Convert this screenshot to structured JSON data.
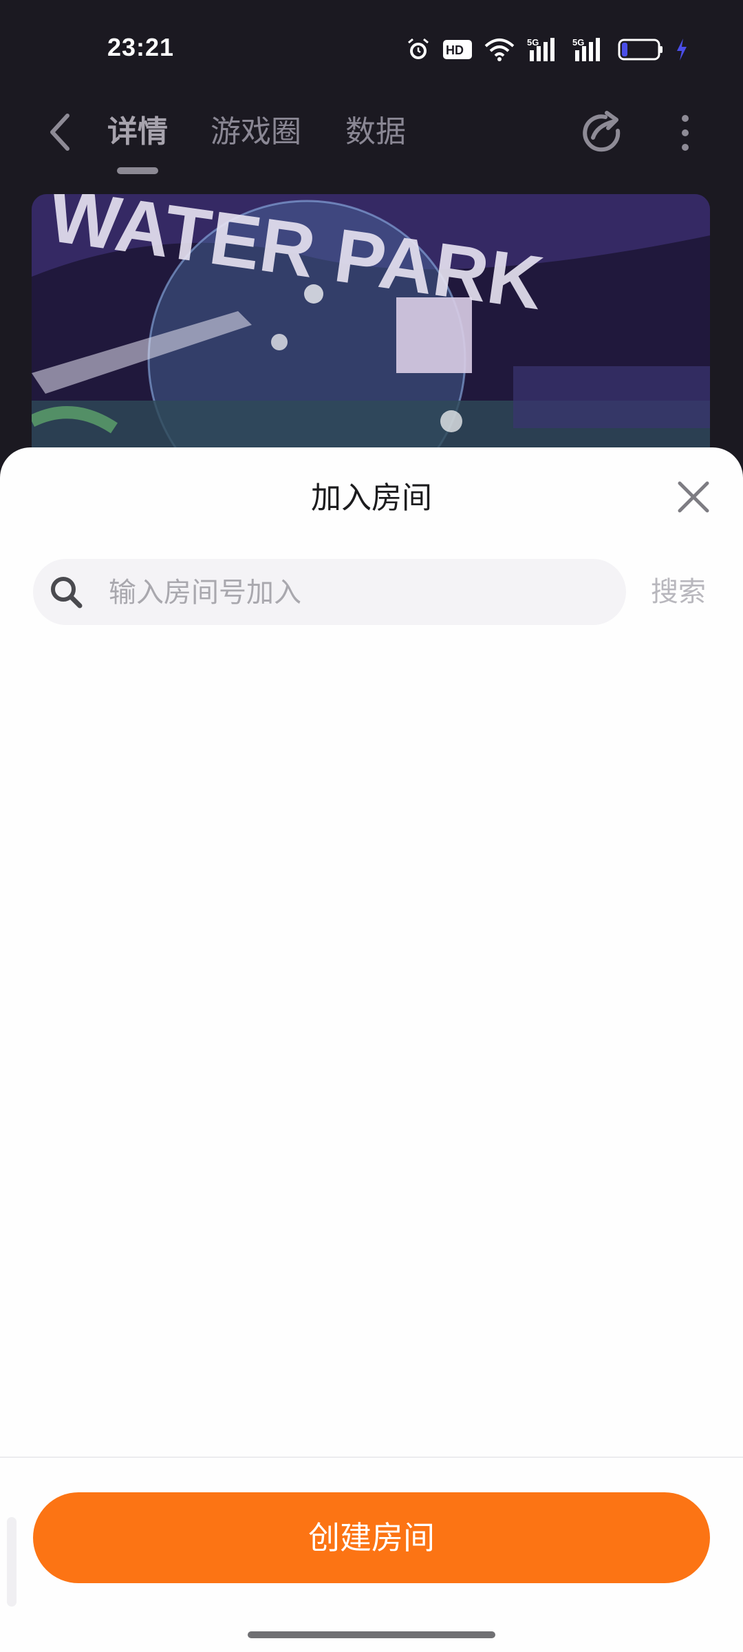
{
  "status_bar": {
    "time": "23:21",
    "icons": [
      "alarm-icon",
      "hd-icon",
      "wifi-icon",
      "signal-5g-icon",
      "signal-5g-icon",
      "battery-icon",
      "charging-icon"
    ],
    "hd_label": "HD",
    "network_1": "5G",
    "network_2": "5G"
  },
  "nav": {
    "tabs": [
      {
        "label": "详情",
        "active": true
      },
      {
        "label": "游戏圈",
        "active": false
      },
      {
        "label": "数据",
        "active": false
      }
    ]
  },
  "banner": {
    "text": "WATER PARK"
  },
  "sheet": {
    "title": "加入房间",
    "search_placeholder": "输入房间号加入",
    "search_button": "搜索",
    "create_button": "创建房间"
  },
  "colors": {
    "accent": "#fc7414",
    "sheet_bg": "#fefefe",
    "search_bg": "#f4f3f6"
  }
}
